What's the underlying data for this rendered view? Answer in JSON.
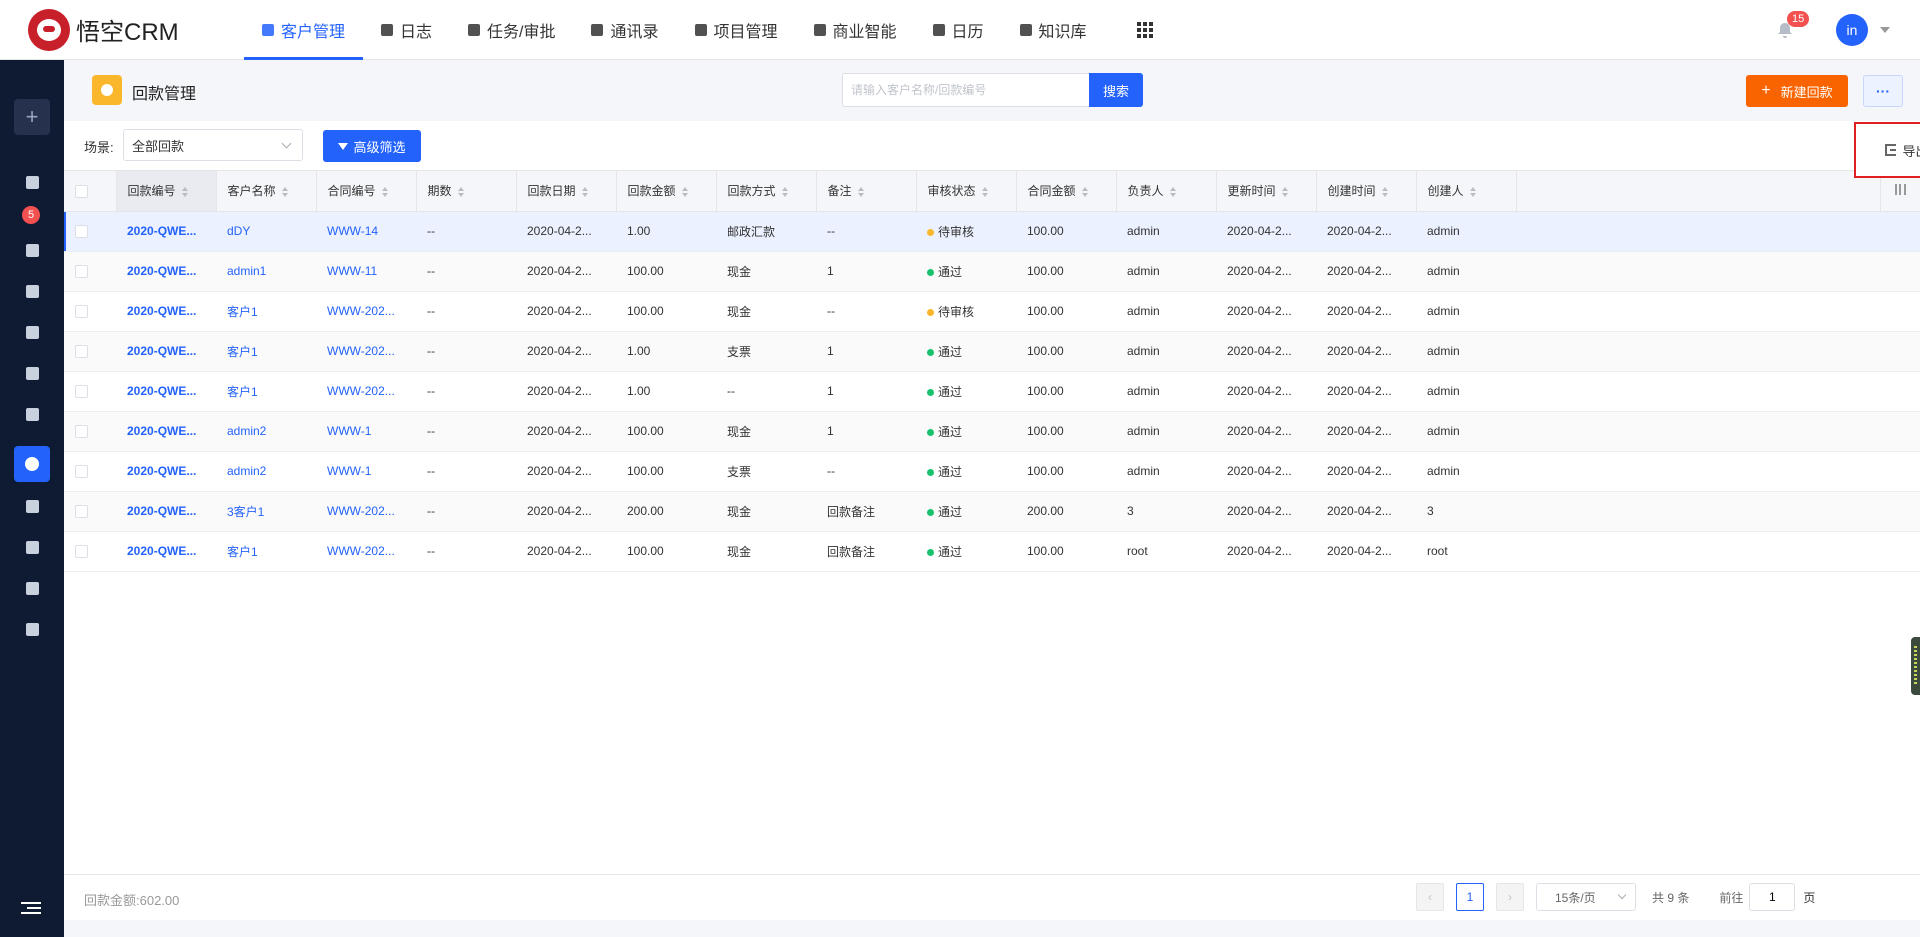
{
  "app": {
    "logo_text": "悟空CRM"
  },
  "nav": [
    {
      "label": "客户管理",
      "icon": "customer-icon",
      "active": true
    },
    {
      "label": "日志",
      "icon": "log-icon"
    },
    {
      "label": "任务/审批",
      "icon": "task-icon"
    },
    {
      "label": "通讯录",
      "icon": "contacts-icon"
    },
    {
      "label": "项目管理",
      "icon": "project-icon"
    },
    {
      "label": "商业智能",
      "icon": "bi-icon"
    },
    {
      "label": "日历",
      "icon": "calendar-icon"
    },
    {
      "label": "知识库",
      "icon": "knowledge-icon"
    }
  ],
  "header_right": {
    "notification_count": "15",
    "avatar_text": "in"
  },
  "sidebar": {
    "add_label": "+",
    "badge": "5"
  },
  "page": {
    "title": "回款管理",
    "search_placeholder": "请输入客户名称/回款编号",
    "search_button": "搜索",
    "new_button": "新建回款",
    "more_button": "···"
  },
  "filters": {
    "scene_label": "场景:",
    "scene_value": "全部回款",
    "advanced_button": "高级筛选"
  },
  "export_menu": {
    "item": "导出"
  },
  "table": {
    "columns": [
      "回款编号",
      "客户名称",
      "合同编号",
      "期数",
      "回款日期",
      "回款金额",
      "回款方式",
      "备注",
      "审核状态",
      "合同金额",
      "负责人",
      "更新时间",
      "创建时间",
      "创建人"
    ],
    "rows": [
      {
        "code": "2020-QWE...",
        "customer": "dDY",
        "contract": "WWW-14",
        "period": "--",
        "date": "2020-04-2...",
        "amount": "1.00",
        "method": "邮政汇款",
        "note": "--",
        "status": "待审核",
        "status_color": "#fbb72c",
        "contract_amount": "100.00",
        "owner": "admin",
        "updated": "2020-04-2...",
        "created": "2020-04-2...",
        "creator": "admin"
      },
      {
        "code": "2020-QWE...",
        "customer": "admin1",
        "contract": "WWW-11",
        "period": "--",
        "date": "2020-04-2...",
        "amount": "100.00",
        "method": "现金",
        "note": "1",
        "status": "通过",
        "status_color": "#19c16f",
        "contract_amount": "100.00",
        "owner": "admin",
        "updated": "2020-04-2...",
        "created": "2020-04-2...",
        "creator": "admin"
      },
      {
        "code": "2020-QWE...",
        "customer": "客户1",
        "contract": "WWW-202...",
        "period": "--",
        "date": "2020-04-2...",
        "amount": "100.00",
        "method": "现金",
        "note": "--",
        "status": "待审核",
        "status_color": "#fbb72c",
        "contract_amount": "100.00",
        "owner": "admin",
        "updated": "2020-04-2...",
        "created": "2020-04-2...",
        "creator": "admin"
      },
      {
        "code": "2020-QWE...",
        "customer": "客户1",
        "contract": "WWW-202...",
        "period": "--",
        "date": "2020-04-2...",
        "amount": "1.00",
        "method": "支票",
        "note": "1",
        "status": "通过",
        "status_color": "#19c16f",
        "contract_amount": "100.00",
        "owner": "admin",
        "updated": "2020-04-2...",
        "created": "2020-04-2...",
        "creator": "admin"
      },
      {
        "code": "2020-QWE...",
        "customer": "客户1",
        "contract": "WWW-202...",
        "period": "--",
        "date": "2020-04-2...",
        "amount": "1.00",
        "method": "--",
        "note": "1",
        "status": "通过",
        "status_color": "#19c16f",
        "contract_amount": "100.00",
        "owner": "admin",
        "updated": "2020-04-2...",
        "created": "2020-04-2...",
        "creator": "admin"
      },
      {
        "code": "2020-QWE...",
        "customer": "admin2",
        "contract": "WWW-1",
        "period": "--",
        "date": "2020-04-2...",
        "amount": "100.00",
        "method": "现金",
        "note": "1",
        "status": "通过",
        "status_color": "#19c16f",
        "contract_amount": "100.00",
        "owner": "admin",
        "updated": "2020-04-2...",
        "created": "2020-04-2...",
        "creator": "admin"
      },
      {
        "code": "2020-QWE...",
        "customer": "admin2",
        "contract": "WWW-1",
        "period": "--",
        "date": "2020-04-2...",
        "amount": "100.00",
        "method": "支票",
        "note": "--",
        "status": "通过",
        "status_color": "#19c16f",
        "contract_amount": "100.00",
        "owner": "admin",
        "updated": "2020-04-2...",
        "created": "2020-04-2...",
        "creator": "admin"
      },
      {
        "code": "2020-QWE...",
        "customer": "3客户1",
        "contract": "WWW-202...",
        "period": "--",
        "date": "2020-04-2...",
        "amount": "200.00",
        "method": "现金",
        "note": "回款备注",
        "status": "通过",
        "status_color": "#19c16f",
        "contract_amount": "200.00",
        "owner": "3",
        "updated": "2020-04-2...",
        "created": "2020-04-2...",
        "creator": "3"
      },
      {
        "code": "2020-QWE...",
        "customer": "客户1",
        "contract": "WWW-202...",
        "period": "--",
        "date": "2020-04-2...",
        "amount": "100.00",
        "method": "现金",
        "note": "回款备注",
        "status": "通过",
        "status_color": "#19c16f",
        "contract_amount": "100.00",
        "owner": "root",
        "updated": "2020-04-2...",
        "created": "2020-04-2...",
        "creator": "root"
      }
    ]
  },
  "footer": {
    "sum_text": "回款金额:602.00",
    "current_page": "1",
    "page_size": "15条/页",
    "total": "共 9 条",
    "goto_label": "前往",
    "goto_value": "1",
    "page_unit": "页"
  },
  "colors": {
    "primary": "#2362fb",
    "accent": "#fa6400",
    "sidebar_bg": "#0f1a33",
    "highlight_border": "#e02020"
  }
}
